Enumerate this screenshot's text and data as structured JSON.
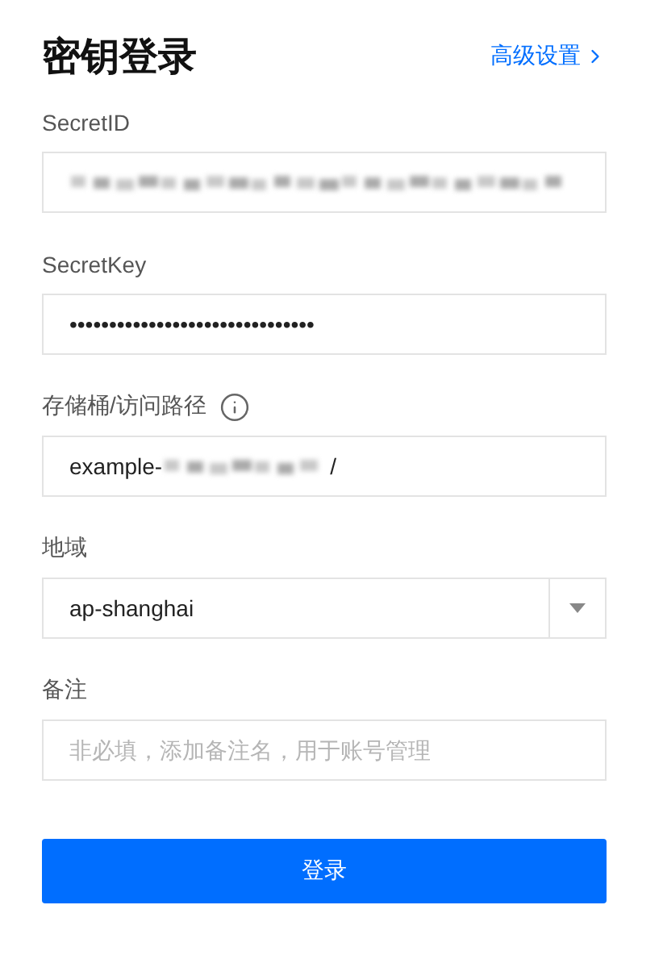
{
  "title": "密钥登录",
  "advanced_link": {
    "label": "高级设置"
  },
  "fields": [
    {
      "kind": "text",
      "label": "SecretID",
      "info_icon": false,
      "value_parts": [
        {
          "kind": "redacted"
        }
      ]
    },
    {
      "kind": "password",
      "label": "SecretKey",
      "info_icon": false,
      "value_parts": [
        {
          "kind": "text",
          "text": "•••••••••••••••••••••••••••••••"
        }
      ]
    },
    {
      "kind": "text",
      "label": "存储桶/访问路径",
      "info_icon": true,
      "value_parts": [
        {
          "kind": "text",
          "text": "example-"
        },
        {
          "kind": "redacted"
        },
        {
          "kind": "text",
          "text": "/"
        }
      ]
    },
    {
      "kind": "select",
      "label": "地域",
      "info_icon": false,
      "value": "ap-shanghai"
    },
    {
      "kind": "text",
      "label": "备注",
      "info_icon": false,
      "placeholder": "非必填，添加备注名，用于账号管理"
    }
  ],
  "submit": {
    "label": "登录"
  }
}
